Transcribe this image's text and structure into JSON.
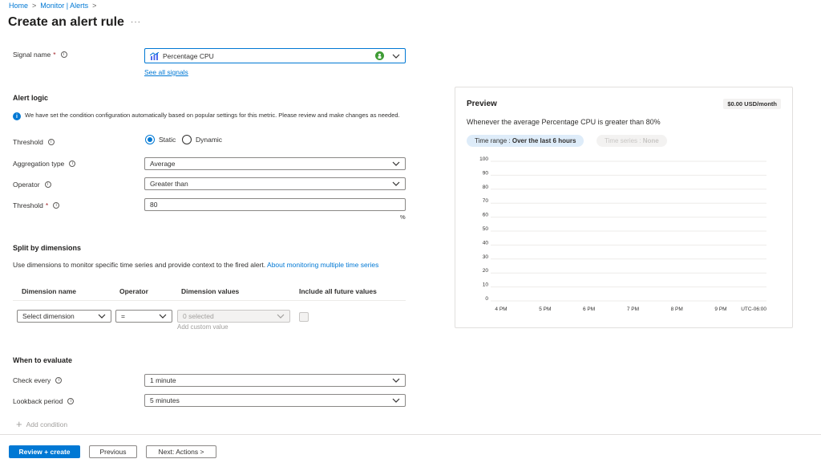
{
  "breadcrumb": {
    "items": [
      "Home",
      "Monitor | Alerts"
    ]
  },
  "page": {
    "title": "Create an alert rule",
    "more": "···"
  },
  "signal": {
    "label": "Signal name",
    "value": "Percentage CPU",
    "see_all": "See all signals"
  },
  "alert_logic": {
    "heading": "Alert logic",
    "info_message": "We have set the condition configuration automatically based on popular settings for this metric. Please review and make changes as needed.",
    "threshold_label": "Threshold",
    "threshold_options": [
      "Static",
      "Dynamic"
    ],
    "threshold_selected": "Static",
    "aggregation_label": "Aggregation type",
    "aggregation_value": "Average",
    "operator_label": "Operator",
    "operator_value": "Greater than",
    "threshold_value_label": "Threshold",
    "threshold_value": "80",
    "threshold_unit": "%"
  },
  "split": {
    "heading": "Split by dimensions",
    "description": "Use dimensions to monitor specific time series and provide context to the fired alert.",
    "link": "About monitoring multiple time series",
    "columns": [
      "Dimension name",
      "Operator",
      "Dimension values",
      "Include all future values"
    ],
    "row": {
      "dimension": "Select dimension",
      "operator": "=",
      "values": "0 selected",
      "add_custom": "Add custom value"
    }
  },
  "evaluate": {
    "heading": "When to evaluate",
    "check_every_label": "Check every",
    "check_every_value": "1 minute",
    "lookback_label": "Lookback period",
    "lookback_value": "5 minutes",
    "add_condition": "Add condition"
  },
  "preview": {
    "title": "Preview",
    "cost": "$0.00 USD/month",
    "summary": "Whenever the average Percentage CPU is greater than 80%",
    "time_range_label": "Time range :",
    "time_range_value": "Over the last 6 hours",
    "time_series_label": "Time series :",
    "time_series_value": "None"
  },
  "chart_data": {
    "type": "line",
    "series": [],
    "y_ticks": [
      "0",
      "10",
      "20",
      "30",
      "40",
      "50",
      "60",
      "70",
      "80",
      "90",
      "100"
    ],
    "x_ticks": [
      "4 PM",
      "5 PM",
      "6 PM",
      "7 PM",
      "8 PM",
      "9 PM"
    ],
    "timezone": "UTC-06:00",
    "ylim": [
      0,
      100
    ],
    "grid": true
  },
  "footer": {
    "review_create": "Review + create",
    "previous": "Previous",
    "next": "Next: Actions >"
  },
  "colors": {
    "accent": "#0078d4",
    "signal_icon": "#4f6bed",
    "status_green": "#3f9c35"
  }
}
